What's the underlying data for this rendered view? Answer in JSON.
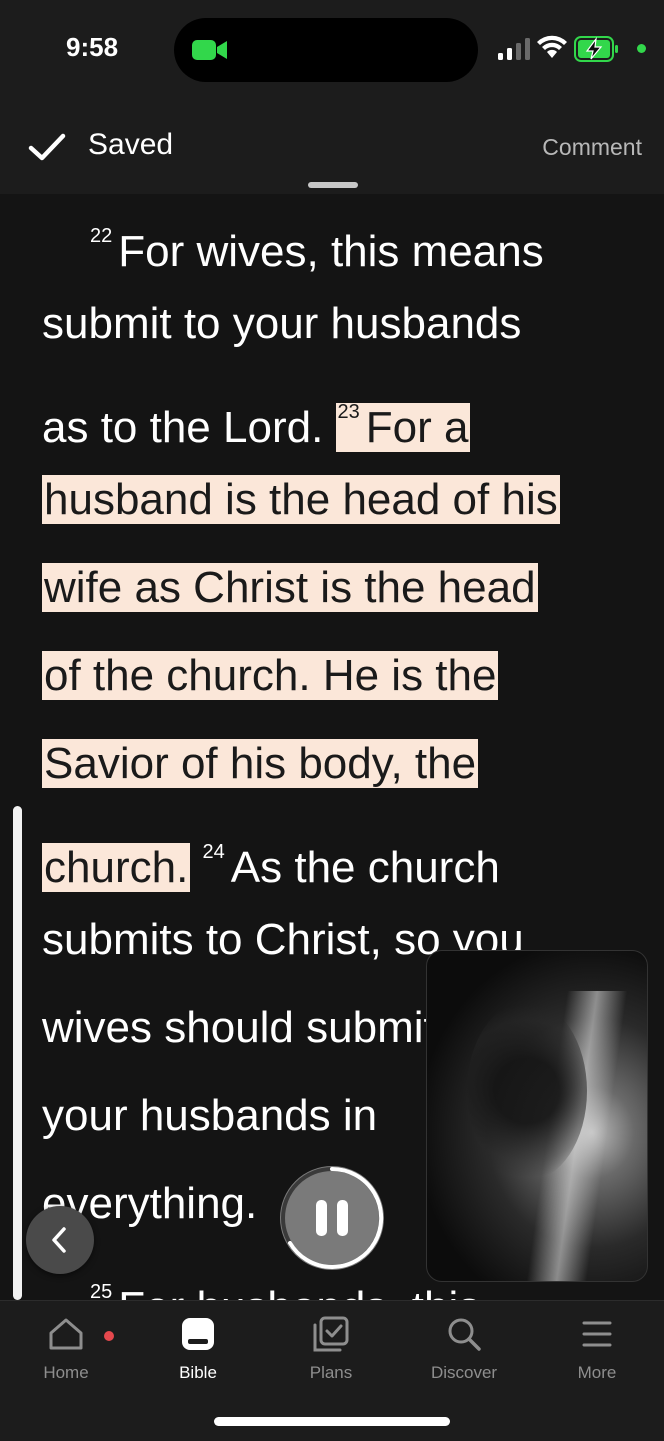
{
  "status": {
    "time": "9:58"
  },
  "topbar": {
    "saved_label": "Saved",
    "comment_label": "Comment"
  },
  "reader": {
    "lines": [
      {
        "num": "22",
        "text": "For wives, this means"
      },
      {
        "text": "submit to your husbands"
      },
      {
        "text": "as to the Lord.",
        "num2": "23",
        "hl_text": "For a"
      },
      {
        "hl_text": "husband is the head of his"
      },
      {
        "hl_text": "wife as Christ is the head"
      },
      {
        "hl_text": "of the church. He is the"
      },
      {
        "hl_text": "Savior of his body, the"
      },
      {
        "hl_text": "church.",
        "num2": "24",
        "text": "As the church"
      },
      {
        "text": "submits to Christ, so you"
      },
      {
        "text": "wives should submit to"
      },
      {
        "text": "your husbands in"
      },
      {
        "text": "everything."
      },
      {
        "num": "25",
        "text": "For husbands, this"
      }
    ],
    "highlight_color": "#fbe7d9"
  },
  "tabs": [
    {
      "label": "Home",
      "icon": "home-icon"
    },
    {
      "label": "Bible",
      "icon": "bible-icon"
    },
    {
      "label": "Plans",
      "icon": "plans-icon"
    },
    {
      "label": "Discover",
      "icon": "search-icon"
    },
    {
      "label": "More",
      "icon": "menu-icon"
    }
  ],
  "colors": {
    "background": "#141414",
    "bar": "#1c1c1c",
    "accent_green": "#32d74b",
    "notification": "#e5484d"
  }
}
